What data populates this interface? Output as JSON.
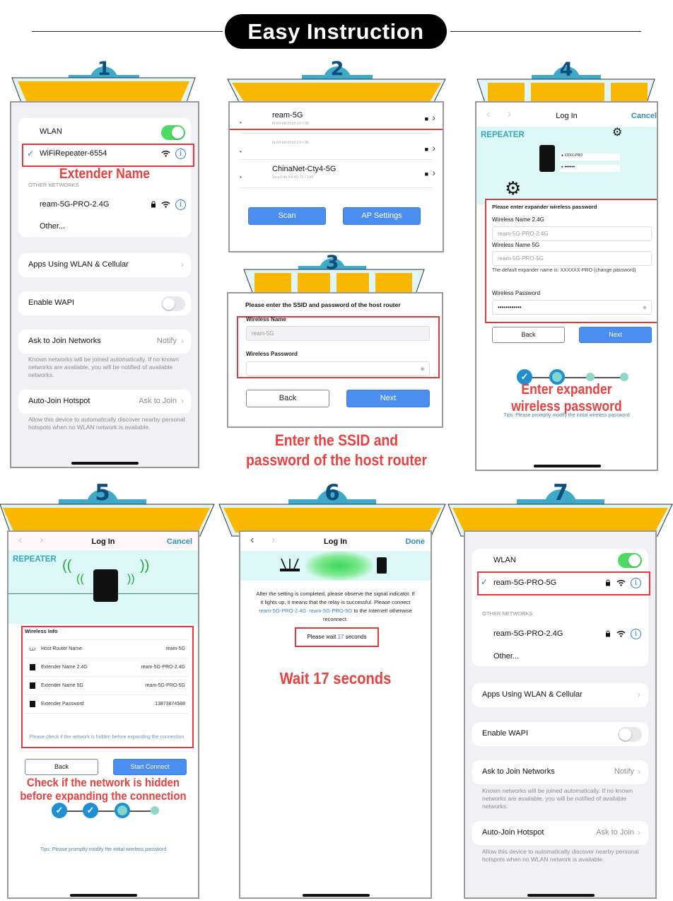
{
  "title": "Easy Instruction",
  "badges": [
    "1",
    "2",
    "3",
    "4",
    "5",
    "6",
    "7"
  ],
  "colors": {
    "banner_yellow": "#fbb800",
    "badge_cyan": "#3ea9c8",
    "annotation_red": "#e8413f",
    "ios_green": "#4cd964",
    "button_blue": "#4a8ef0",
    "link_blue": "#2a7bd6"
  },
  "step1": {
    "wlan_label": "WLAN",
    "wlan_on": true,
    "connected_network": "WiFiRepeater-6554",
    "annotation": "Extender Name",
    "other_networks_label": "OTHER NETWORKS",
    "network": "ream-5G-PRO-2.4G",
    "other_label": "Other...",
    "apps_label": "Apps Using WLAN & Cellular",
    "wapi_label": "Enable WAPI",
    "wapi_on": false,
    "ask_join_label": "Ask to Join Networks",
    "ask_join_value": "Notify",
    "ask_join_note": "Known networks will be joined automatically. If no known networks are available, you will be notified of available networks.",
    "auto_join_label": "Auto-Join Hotspot",
    "auto_join_value": "Ask to Join",
    "auto_join_note": "Allow this device to automatically discover nearby personal hotspots when no WLAN network is available."
  },
  "step2": {
    "networks": [
      {
        "name": "ream-5G",
        "mac": "f6:64:b8:0f:b0:14 / 36"
      },
      {
        "name": "",
        "mac": "fa:64:b8:df:b0:14 / 36"
      },
      {
        "name": "ChinaNet-Cty4-5G",
        "mac": "2a:e3:4e:64:49:70 / 149"
      }
    ],
    "scan_label": "Scan",
    "ap_settings_label": "AP Settings"
  },
  "step3": {
    "heading": "Please enter the SSID and password of the host router",
    "name_label": "Wireless Name",
    "name_value": "ream-5G",
    "password_label": "Wireless Password",
    "back_label": "Back",
    "next_label": "Next",
    "caption_line1": "Enter the SSID and",
    "caption_line2": "password of the host router"
  },
  "step4": {
    "nav_title": "Log In",
    "cancel_label": "Cancel",
    "brand": "REPEATER",
    "login_user": "XXXX-PRO",
    "login_pass": "••••••",
    "heading": "Please enter expander wireless password",
    "name24_label": "Wireless Name 2.4G",
    "name24_value": "ream-5G-PRO-2.4G",
    "name5_label": "Wireless Name 5G",
    "name5_value": "ream-5G-PRO-5G",
    "default_note": "The default expander name is: XXXXXX-PRO (change password)",
    "password_label": "Wireless Password",
    "password_value": "••••••••••••",
    "back_label": "Back",
    "next_label": "Next",
    "progress_step": 2,
    "caption_line1": "Enter expander",
    "caption_line2": "wireless password",
    "tips": "Tips: Please promptly modify the initial wireless password"
  },
  "step5": {
    "nav_title": "Log In",
    "cancel_label": "Cancel",
    "brand": "REPEATER",
    "info_title": "Wireless Info",
    "rows": [
      {
        "label": "Host Router Name",
        "value": "ream-5G"
      },
      {
        "label": "Extender Name 2.4G",
        "value": "ream-5G-PRO-2.4G"
      },
      {
        "label": "Extender Name 5G",
        "value": "ream-5G-PRO-5G"
      },
      {
        "label": "Extender Password",
        "value": "13873874588"
      }
    ],
    "hidden_note": "Please check if the network is hidden before expanding the connection",
    "back_label": "Back",
    "connect_label": "Start Connect",
    "progress_step": 3,
    "caption_line1": "Check if the network is hidden",
    "caption_line2": "before expanding the connection",
    "tips": "Tips: Please promptly modify the initial wireless password"
  },
  "step6": {
    "nav_title": "Log In",
    "done_label": "Done",
    "msg_1": "After the setting is completed, please observe the signal indicator. If it lights up, it means that the relay is successful. Please connect ",
    "msg_link1": "ream-5G-PRO-2.4G",
    "msg_link2": "ream-5G-PRO-5G",
    "msg_2": " to the Internet! otherwise reconnect.",
    "wait_prefix": "Please wait ",
    "wait_seconds": "17",
    "wait_suffix": " seconds",
    "caption": "Wait 17 seconds"
  },
  "step7": {
    "wlan_label": "WLAN",
    "wlan_on": true,
    "connected_network": "ream-5G-PRO-5G",
    "other_networks_label": "OTHER NETWORKS",
    "network": "ream-5G-PRO-2.4G",
    "other_label": "Other...",
    "apps_label": "Apps Using WLAN & Cellular",
    "wapi_label": "Enable WAPI",
    "wapi_on": false,
    "ask_join_label": "Ask to Join Networks",
    "ask_join_value": "Notify",
    "ask_join_note": "Known networks will be joined automatically. If no known networks are available, you will be notified of available networks.",
    "auto_join_label": "Auto-Join Hotspot",
    "auto_join_value": "Ask to Join",
    "auto_join_note": "Allow this device to automatically discover nearby personal hotspots when no WLAN network is available."
  }
}
